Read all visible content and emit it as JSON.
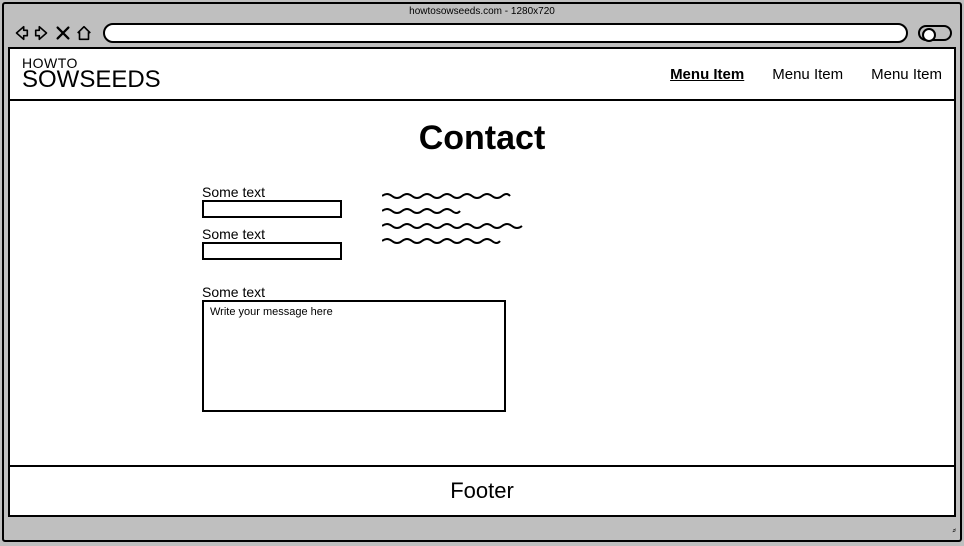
{
  "browser": {
    "title": "howtosowseeds.com - 1280x720"
  },
  "header": {
    "logo_top": "HOWTO",
    "logo_bottom": "SOWSEEDS",
    "menu": [
      {
        "label": "Menu Item",
        "active": true
      },
      {
        "label": "Menu Item",
        "active": false
      },
      {
        "label": "Menu Item",
        "active": false
      }
    ]
  },
  "main": {
    "title": "Contact",
    "form": {
      "field1_label": "Some text",
      "field2_label": "Some text",
      "message_label": "Some text",
      "message_placeholder": "Write your message here"
    }
  },
  "footer": {
    "label": "Footer"
  }
}
